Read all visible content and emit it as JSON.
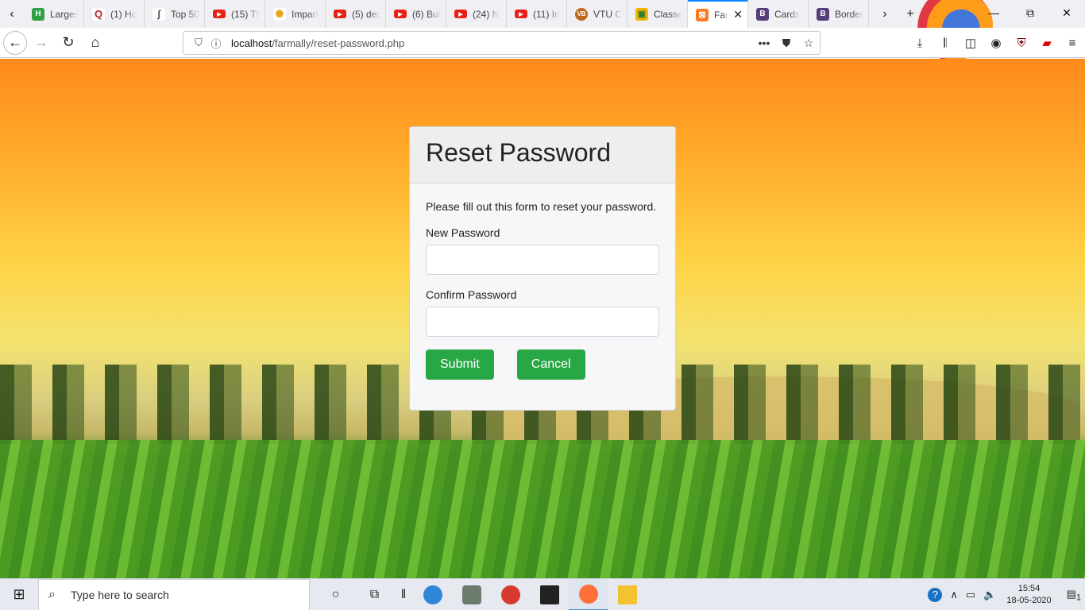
{
  "browser": {
    "tabs": [
      {
        "label": "Larges",
        "icon": "h-icon",
        "color": "#2ea043"
      },
      {
        "label": "(1) Ho",
        "icon": "quora-icon",
        "color": "#b92b27"
      },
      {
        "label": "Top 50",
        "icon": "bracket-icon",
        "color": "#555555"
      },
      {
        "label": "(15) Th",
        "icon": "youtube-icon",
        "color": "#e62117"
      },
      {
        "label": "Impart",
        "icon": "impart-icon",
        "color": "#e8a317"
      },
      {
        "label": "(5) dec",
        "icon": "youtube-icon",
        "color": "#e62117"
      },
      {
        "label": "(6) But",
        "icon": "youtube-icon",
        "color": "#e62117"
      },
      {
        "label": "(24) N",
        "icon": "youtube-icon",
        "color": "#e62117"
      },
      {
        "label": "(11) In",
        "icon": "youtube-icon",
        "color": "#e62117"
      },
      {
        "label": "VTU C",
        "icon": "vtu-icon",
        "color": "#c0651a"
      },
      {
        "label": "Classe",
        "icon": "classroom-icon",
        "color": "#f4b400"
      },
      {
        "label": "Far",
        "icon": "xampp-icon",
        "color": "#fb7a24",
        "active": true
      },
      {
        "label": "Cards",
        "icon": "bootstrap-icon",
        "color": "#563d7c"
      },
      {
        "label": "Border",
        "icon": "bootstrap-icon",
        "color": "#563d7c"
      }
    ],
    "url_host": "localhost",
    "url_path": "/farmally/reset-password.php"
  },
  "form": {
    "title": "Reset Password",
    "intro": "Please fill out this form to reset your password.",
    "new_password_label": "New Password",
    "new_password_value": "",
    "confirm_password_label": "Confirm Password",
    "confirm_password_value": "",
    "submit_label": "Submit",
    "cancel_label": "Cancel",
    "button_color": "#28a745"
  },
  "taskbar": {
    "search_placeholder": "Type here to search",
    "time": "15:54",
    "date": "18-05-2020",
    "notification_count": "1"
  }
}
